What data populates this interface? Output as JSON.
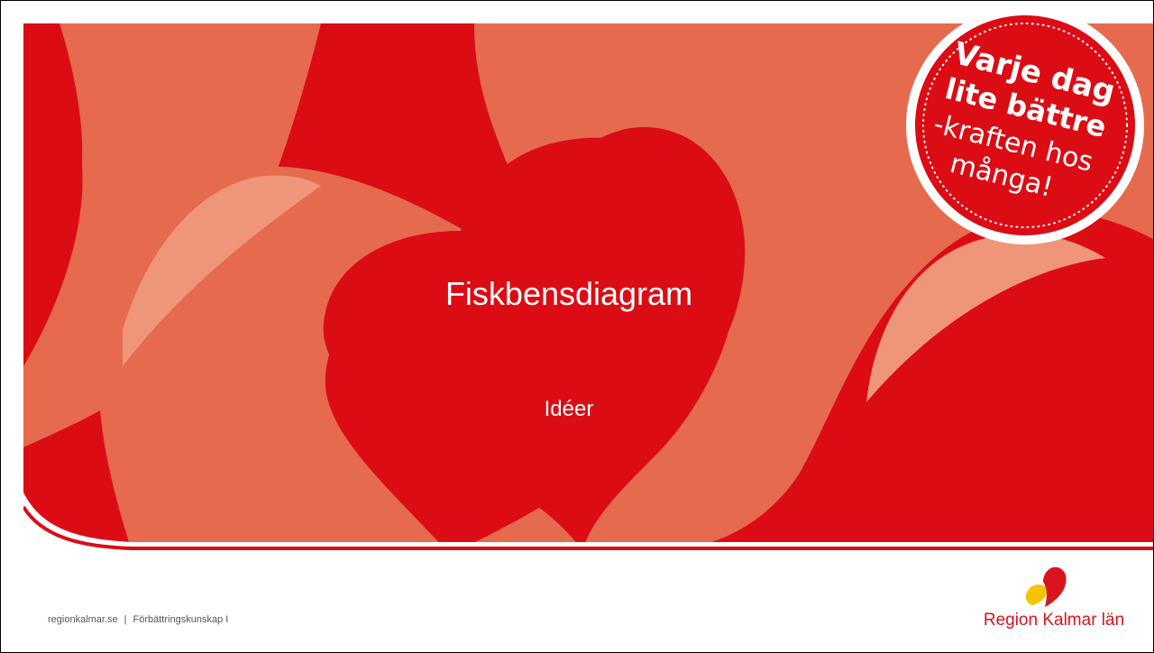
{
  "slide": {
    "title": "Fiskbensdiagram",
    "subtitle": "Idéer"
  },
  "badge": {
    "line1": "Varje dag",
    "line2": "lite bättre",
    "line3": "-kraften hos",
    "line4": "många!"
  },
  "footer": {
    "site": "regionkalmar.se",
    "separator": "|",
    "section": "Förbättringskunskap I"
  },
  "logo": {
    "text": "Region Kalmar län",
    "icon": "heart-logo-icon"
  },
  "colors": {
    "brand_red": "#dc0c15",
    "salmon": "#e66a4d",
    "light_salmon": "#ef967a",
    "logo_yellow": "#f5c400"
  }
}
